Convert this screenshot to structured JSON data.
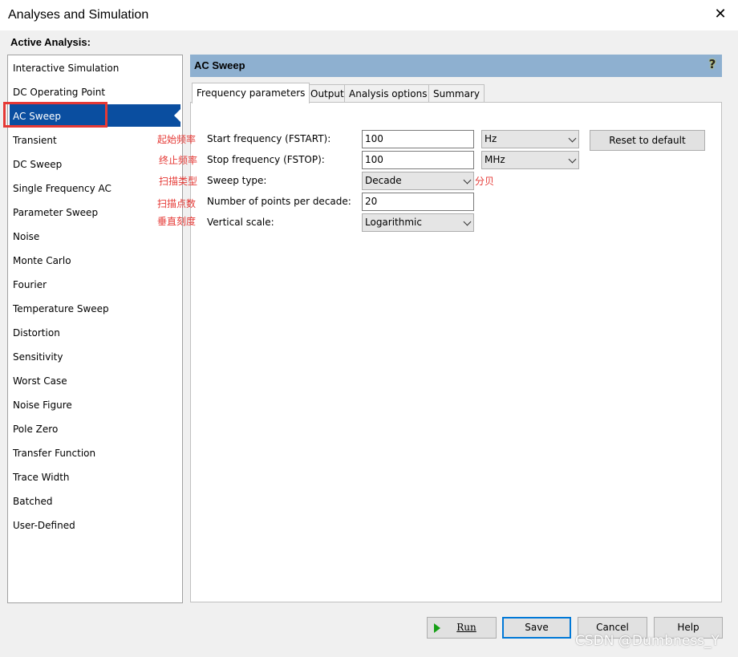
{
  "window": {
    "title": "Analyses and Simulation",
    "close_glyph": "✕"
  },
  "active_analysis_label": "Active Analysis:",
  "analyses": [
    "Interactive Simulation",
    "DC Operating Point",
    "AC Sweep",
    "Transient",
    "DC Sweep",
    "Single Frequency AC",
    "Parameter Sweep",
    "Noise",
    "Monte Carlo",
    "Fourier",
    "Temperature Sweep",
    "Distortion",
    "Sensitivity",
    "Worst Case",
    "Noise Figure",
    "Pole Zero",
    "Transfer Function",
    "Trace Width",
    "Batched",
    "User-Defined"
  ],
  "selected_analysis": "AC Sweep",
  "panel": {
    "title": "AC Sweep",
    "help_glyph": "?",
    "tabs": [
      "Frequency parameters",
      "Output",
      "Analysis options",
      "Summary"
    ],
    "active_tab": "Frequency parameters"
  },
  "annotations": {
    "start": "起始频率",
    "stop": "终止频率",
    "sweep_type": "扫描类型",
    "points": "扫描点数",
    "vscale": "垂直刻度",
    "decade": "分贝"
  },
  "fields": {
    "start_label": "Start frequency (FSTART):",
    "start_value": "100",
    "start_unit": "Hz",
    "stop_label": "Stop frequency (FSTOP):",
    "stop_value": "100",
    "stop_unit": "MHz",
    "sweep_label": "Sweep type:",
    "sweep_value": "Decade",
    "points_label": "Number of points per decade:",
    "points_value": "20",
    "vscale_label": "Vertical scale:",
    "vscale_value": "Logarithmic"
  },
  "reset_button": "Reset to default",
  "buttons": {
    "run": "Run",
    "save": "Save",
    "cancel": "Cancel",
    "help": "Help"
  },
  "watermark": "CSDN @Dumbness_Y",
  "colors": {
    "selected": "#0a4ea0",
    "header": "#8eb0d0",
    "annotation": "#e53935",
    "focus": "#0078d7"
  }
}
